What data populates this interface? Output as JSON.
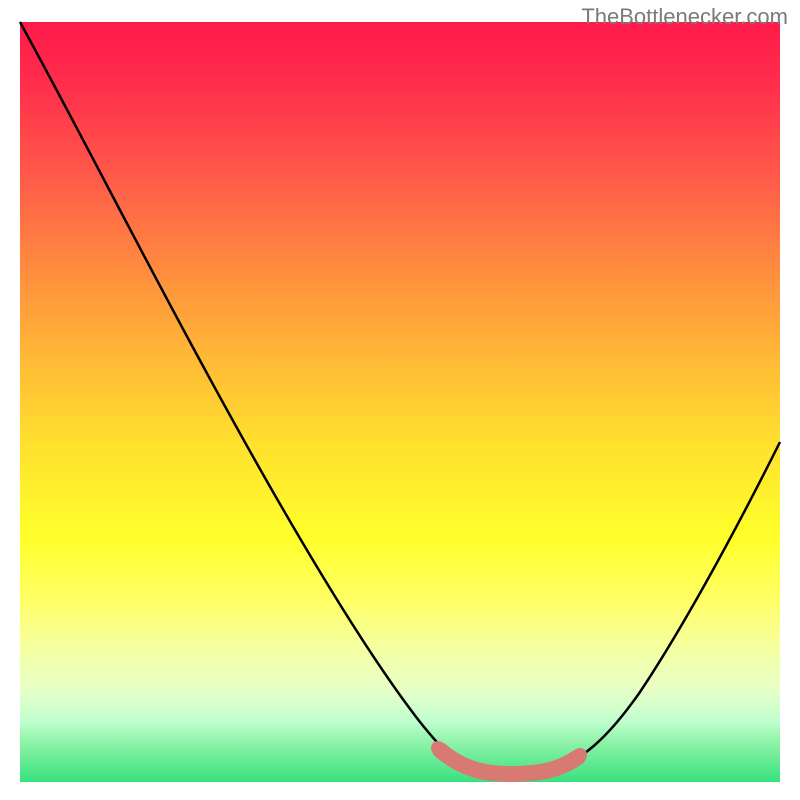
{
  "attribution": "TheBottlenecker.com",
  "chart_data": {
    "type": "line",
    "title": "",
    "xlabel": "",
    "ylabel": "",
    "xlim": [
      0,
      100
    ],
    "ylim": [
      0,
      100
    ],
    "grid": false,
    "legend": false,
    "background_gradient": {
      "direction": "vertical",
      "stops": [
        {
          "pos": 0,
          "color": "#ff1a4b"
        },
        {
          "pos": 44,
          "color": "#ffe22e"
        },
        {
          "pos": 100,
          "color": "#38e17d"
        }
      ]
    },
    "series": [
      {
        "name": "bottleneck-curve",
        "x": [
          0,
          10,
          20,
          30,
          40,
          50,
          55,
          58,
          62,
          66,
          70,
          76,
          80,
          90,
          100
        ],
        "y": [
          100,
          84,
          68,
          52,
          35,
          18,
          8,
          3,
          0,
          0,
          1,
          4,
          10,
          28,
          48
        ],
        "stroke": "#000000",
        "stroke_width": 2
      },
      {
        "name": "optimal-zone",
        "x": [
          55,
          58,
          62,
          66,
          70,
          73
        ],
        "y": [
          3,
          1,
          0,
          0,
          1,
          3
        ],
        "stroke": "#d87a73",
        "stroke_width": 10
      }
    ],
    "notes": "Heat-map style gradient background from red (high bottleneck) at top through yellow to green (no bottleneck) at bottom. A black V-shaped curve descends steeply from the top-left to a flat minimum around x≈60–70, then rises more gently toward the right. The minimum region of the curve is overdrawn with a thick muted-red highlight."
  }
}
